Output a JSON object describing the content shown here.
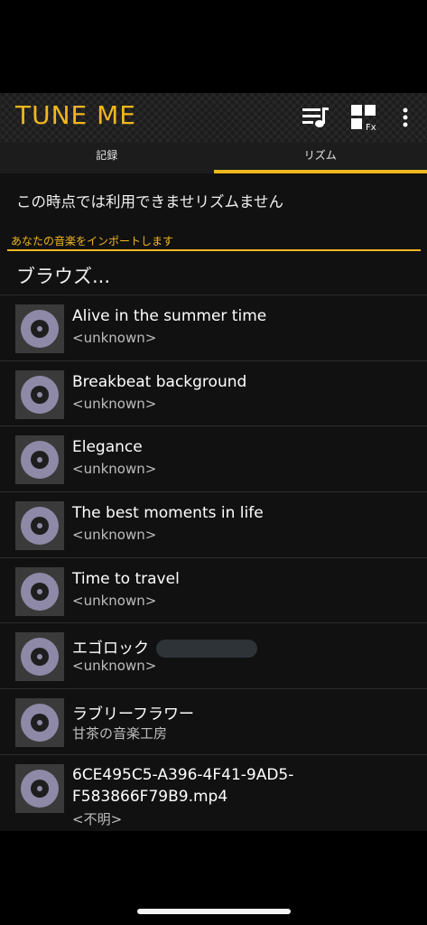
{
  "app": {
    "title": "TUNE ME"
  },
  "toolbar": {
    "playlist_icon": "playlist-music-icon",
    "fx_icon": "grid-fx-icon",
    "fx_label": "Fx",
    "more_icon": "more-vertical-icon"
  },
  "tabs": [
    {
      "label": "記録"
    },
    {
      "label": "リズム"
    }
  ],
  "notice": "この時点では利用できませリズムません",
  "section": {
    "header": "あなたの音楽をインポートします"
  },
  "browse_label": "ブラウズ...",
  "tracks": [
    {
      "title": "Alive in the summer time",
      "subtitle": "<unknown>"
    },
    {
      "title": "Breakbeat background",
      "subtitle": "<unknown>"
    },
    {
      "title": "Elegance",
      "subtitle": "<unknown>"
    },
    {
      "title": "The best moments in life",
      "subtitle": "<unknown>"
    },
    {
      "title": "Time to travel",
      "subtitle": "<unknown>"
    },
    {
      "title": "エゴロック",
      "subtitle": "<unknown>"
    },
    {
      "title": "ラブリーフラワー",
      "subtitle": "甘茶の音楽工房"
    },
    {
      "title": "6CE495C5-A396-4F41-9AD5-F583866F79B9.mp4",
      "subtitle": "<不明>"
    }
  ],
  "colors": {
    "accent": "#f2b61f",
    "background": "#111111",
    "bar": "#1c1c1c",
    "disc": "#8e89a6"
  }
}
